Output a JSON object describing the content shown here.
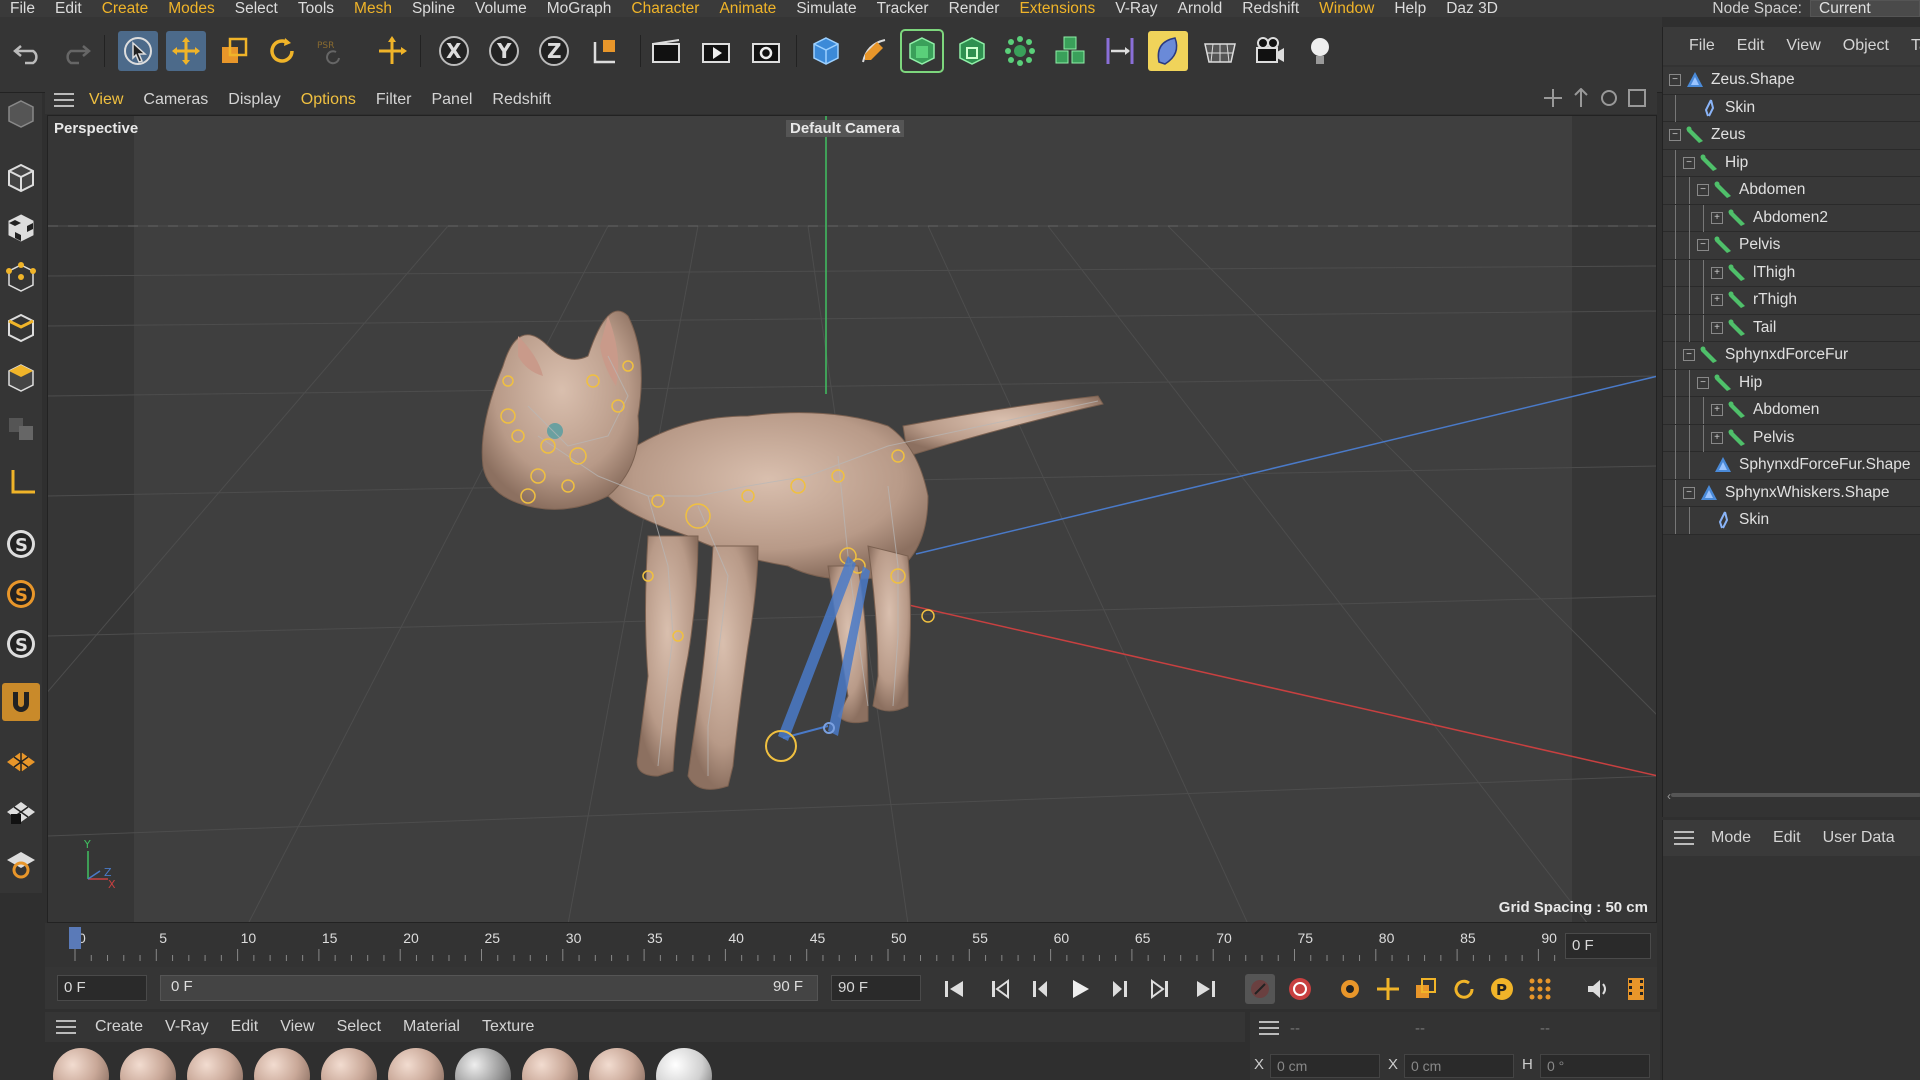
{
  "menubar": {
    "items": [
      {
        "label": "File",
        "hl": false
      },
      {
        "label": "Edit",
        "hl": false
      },
      {
        "label": "Create",
        "hl": true
      },
      {
        "label": "Modes",
        "hl": true
      },
      {
        "label": "Select",
        "hl": false
      },
      {
        "label": "Tools",
        "hl": false
      },
      {
        "label": "Mesh",
        "hl": true
      },
      {
        "label": "Spline",
        "hl": false
      },
      {
        "label": "Volume",
        "hl": false
      },
      {
        "label": "MoGraph",
        "hl": false
      },
      {
        "label": "Character",
        "hl": true
      },
      {
        "label": "Animate",
        "hl": true
      },
      {
        "label": "Simulate",
        "hl": false
      },
      {
        "label": "Tracker",
        "hl": false
      },
      {
        "label": "Render",
        "hl": false
      },
      {
        "label": "Extensions",
        "hl": true
      },
      {
        "label": "V-Ray",
        "hl": false
      },
      {
        "label": "Arnold",
        "hl": false
      },
      {
        "label": "Redshift",
        "hl": false
      },
      {
        "label": "Window",
        "hl": true
      },
      {
        "label": "Help",
        "hl": false
      },
      {
        "label": "Daz 3D",
        "hl": false
      }
    ],
    "node_space_label": "Node Space:",
    "node_space_value": "Current (Standard"
  },
  "viewport_menu": {
    "items": [
      {
        "label": "View",
        "hl": true
      },
      {
        "label": "Cameras",
        "hl": false
      },
      {
        "label": "Display",
        "hl": false
      },
      {
        "label": "Options",
        "hl": true
      },
      {
        "label": "Filter",
        "hl": false
      },
      {
        "label": "Panel",
        "hl": false
      },
      {
        "label": "Redshift",
        "hl": false
      }
    ]
  },
  "viewport": {
    "projection": "Perspective",
    "camera": "Default Camera",
    "grid_spacing": "Grid Spacing : 50 cm"
  },
  "timeline": {
    "ticks": [
      "0",
      "5",
      "10",
      "15",
      "20",
      "25",
      "30",
      "35",
      "40",
      "45",
      "50",
      "55",
      "60",
      "65",
      "70",
      "75",
      "80",
      "85",
      "90"
    ],
    "current_frame": "0 F"
  },
  "playback": {
    "start_frame": "0 F",
    "range_start": "0 F",
    "range_end": "90 F",
    "end_frame": "90 F"
  },
  "material_manager": {
    "menu": [
      "Create",
      "V-Ray",
      "Edit",
      "View",
      "Select",
      "Material",
      "Texture"
    ],
    "materials": [
      "skin",
      "skin",
      "skin",
      "skin",
      "skin",
      "skin",
      "grey",
      "skin",
      "skin",
      "white"
    ]
  },
  "coordinates": {
    "headers": [
      "--",
      "--",
      "--"
    ],
    "x_label": "X",
    "x_value": "0 cm",
    "x2_label": "X",
    "x2_value": "0 cm",
    "h_label": "H",
    "h_value": "0 °"
  },
  "object_manager": {
    "menu": [
      "File",
      "Edit",
      "View",
      "Object",
      "Ta"
    ],
    "rows": [
      {
        "name": "Zeus.Shape",
        "indent": 0,
        "expand": "−",
        "icon": "shape"
      },
      {
        "name": "Skin",
        "indent": 1,
        "expand": "",
        "icon": "skin"
      },
      {
        "name": "Zeus",
        "indent": 0,
        "expand": "−",
        "icon": "bone"
      },
      {
        "name": "Hip",
        "indent": 1,
        "expand": "−",
        "icon": "bone"
      },
      {
        "name": "Abdomen",
        "indent": 2,
        "expand": "−",
        "icon": "bone"
      },
      {
        "name": "Abdomen2",
        "indent": 3,
        "expand": "+",
        "icon": "bone"
      },
      {
        "name": "Pelvis",
        "indent": 2,
        "expand": "−",
        "icon": "bone"
      },
      {
        "name": "lThigh",
        "indent": 3,
        "expand": "+",
        "icon": "bone"
      },
      {
        "name": "rThigh",
        "indent": 3,
        "expand": "+",
        "icon": "bone"
      },
      {
        "name": "Tail",
        "indent": 3,
        "expand": "+",
        "icon": "bone"
      },
      {
        "name": "SphynxdForceFur",
        "indent": 1,
        "expand": "−",
        "icon": "bone"
      },
      {
        "name": "Hip",
        "indent": 2,
        "expand": "−",
        "icon": "bone"
      },
      {
        "name": "Abdomen",
        "indent": 3,
        "expand": "+",
        "icon": "bone"
      },
      {
        "name": "Pelvis",
        "indent": 3,
        "expand": "+",
        "icon": "bone"
      },
      {
        "name": "SphynxdForceFur.Shape",
        "indent": 2,
        "expand": "",
        "icon": "shape"
      },
      {
        "name": "SphynxWhiskers.Shape",
        "indent": 1,
        "expand": "−",
        "icon": "shape"
      },
      {
        "name": "Skin",
        "indent": 2,
        "expand": "",
        "icon": "skin"
      }
    ]
  },
  "attribute_manager": {
    "menu": [
      "Mode",
      "Edit",
      "User Data"
    ]
  },
  "colors": {
    "accent_orange": "#f0b429",
    "active_blue": "#4c6a8a",
    "axis_x": "#c84040",
    "axis_y": "#40c060",
    "axis_z": "#4a7ac8",
    "bone_green": "#4fc06a"
  }
}
